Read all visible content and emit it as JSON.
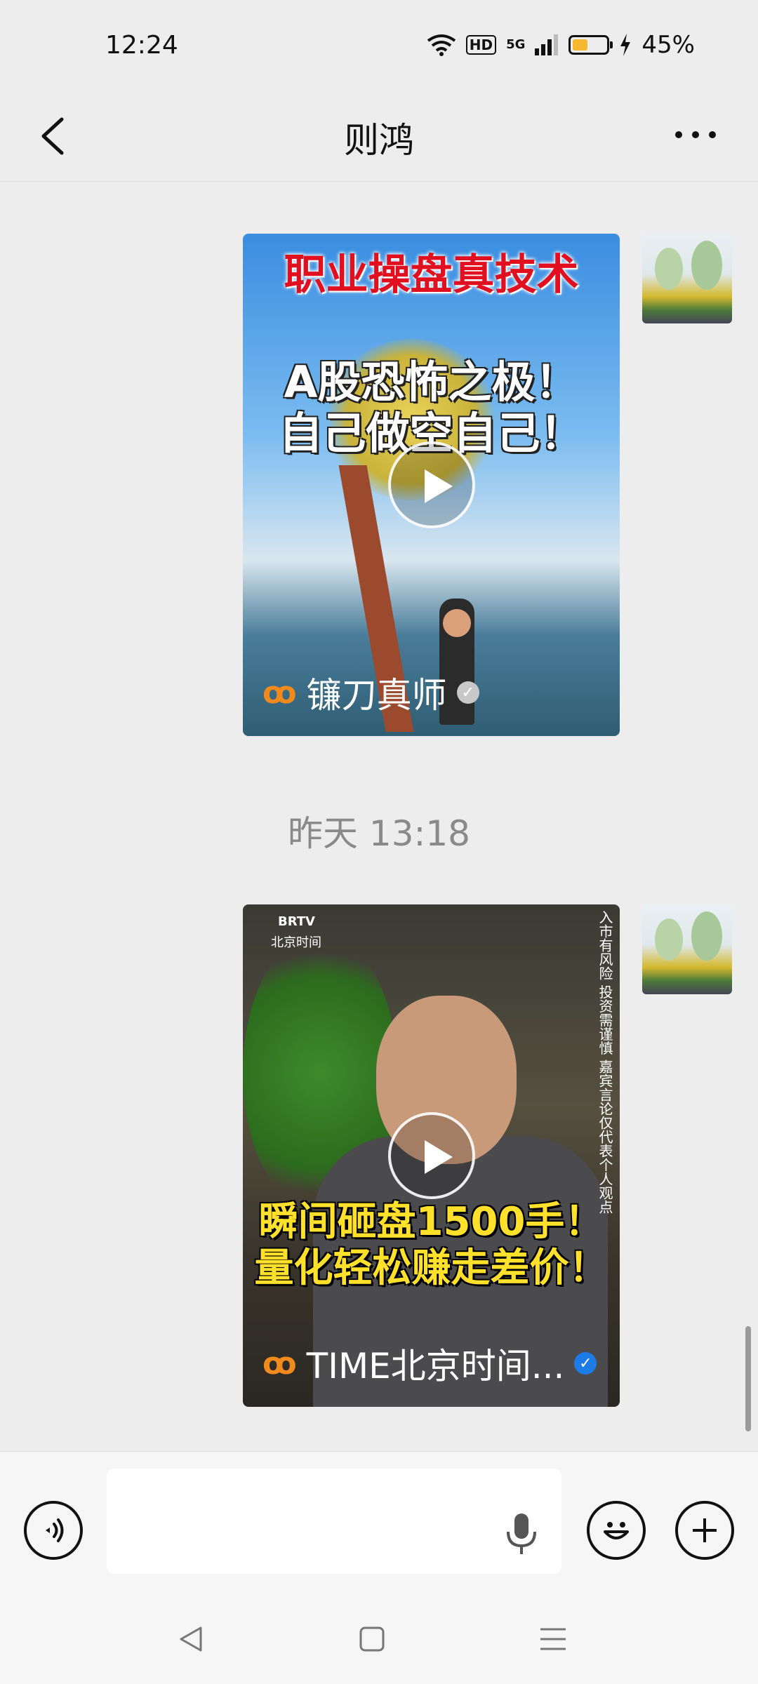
{
  "status_bar": {
    "time": "12:24",
    "hd": "HD",
    "network": "5G",
    "battery_percent": "45%",
    "battery_level": 0.45
  },
  "header": {
    "title": "则鸿"
  },
  "messages": [
    {
      "type": "video",
      "banner": "职业操盘真技术",
      "headline_line1": "A股恐怖之极！",
      "headline_line2": "自己做空自己！",
      "channel": "镰刀真师",
      "verified": "grey"
    },
    {
      "type": "timestamp",
      "text": "昨天 13:18"
    },
    {
      "type": "video",
      "brand": "BRTV",
      "brand_sub": "北京时间",
      "notice": "入市有风险 投资需谨慎 嘉宾言论仅代表个人观点",
      "headline_line1": "瞬间砸盘1500手！",
      "headline_line2": "量化轻松赚走差价！",
      "channel": "TIME北京时间...",
      "verified": "blue"
    }
  ],
  "input_bar": {
    "placeholder": ""
  },
  "colors": {
    "background": "#ededed",
    "channel_logo": "#f08a1c",
    "verified_blue": "#1d7be8",
    "battery": "#f7b731"
  },
  "icons": {
    "back": "chevron-left-icon",
    "more": "more-horizontal-icon",
    "voice": "voice-wave-icon",
    "mic": "microphone-icon",
    "emoji": "smiley-icon",
    "plus": "plus-circle-icon",
    "play": "play-icon",
    "nav_back": "triangle-back-icon",
    "nav_home": "square-home-icon",
    "nav_menu": "menu-lines-icon"
  }
}
